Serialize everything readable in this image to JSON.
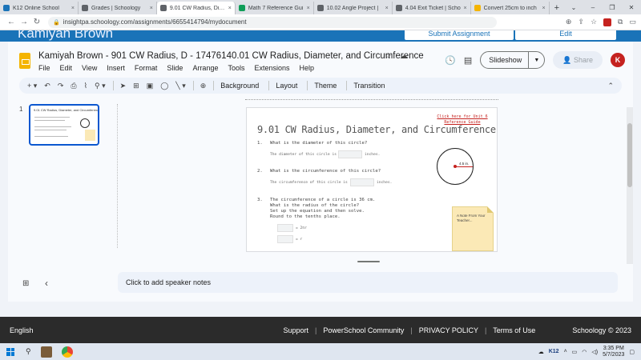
{
  "browser": {
    "tabs": [
      {
        "label": "K12 Online School",
        "color": "#1a73b8",
        "active": false
      },
      {
        "label": "Grades | Schoology",
        "color": "#5f6368",
        "active": false
      },
      {
        "label": "9.01 CW Radius, Diam",
        "color": "#5f6368",
        "active": true
      },
      {
        "label": "Math 7 Reference Gui",
        "color": "#0f9d58",
        "active": false
      },
      {
        "label": "10.02 Angle Project |",
        "color": "#5f6368",
        "active": false
      },
      {
        "label": "4.04 Exit Ticket | Scho",
        "color": "#5f6368",
        "active": false
      },
      {
        "label": "Convert 25cm to inch",
        "color": "#f4b400",
        "active": false
      }
    ],
    "new_tab": "+",
    "close_glyph": "×",
    "url": "insightpa.schoology.com/assignments/6655414794/mydocument"
  },
  "banner": {
    "user_name": "Kamiyah Brown",
    "submit_label": "Submit Assignment",
    "edit_label": "Edit"
  },
  "slides_app": {
    "title": "Kamiyah Brown - 901 CW Radius, D - 17476140.01 CW Radius, Diameter, and Circumference",
    "menus": [
      "File",
      "Edit",
      "View",
      "Insert",
      "Format",
      "Slide",
      "Arrange",
      "Tools",
      "Extensions",
      "Help"
    ],
    "slideshow_label": "Slideshow",
    "share_label": "Share",
    "avatar_letter": "K",
    "toolbar_text": [
      "Background",
      "Layout",
      "Theme",
      "Transition"
    ],
    "slide_number": "1",
    "speaker_notes_placeholder": "Click to add speaker notes"
  },
  "slide": {
    "title": "9.01 CW Radius, Diameter, and Circumference",
    "link_text": "Click here for Unit 6 Reference Guide",
    "q1_num": "1.",
    "q1": "What is the diameter of this circle?",
    "q1_answer_prefix": "The diameter of this circle is",
    "q1_answer_suffix": "inches.",
    "q2_num": "2.",
    "q2": "What is the circumference of this circle?",
    "q2_answer_prefix": "The circumference of this circle is",
    "q2_answer_suffix": "inches.",
    "q3_num": "3.",
    "q3_lines": [
      "The circumference of a circle is 36 cm.",
      "What is the radius of the circle?",
      "Set up the equation and then solve.",
      "Round to the tenths place."
    ],
    "eq1": "= 2πr",
    "eq2": "= r",
    "circle_label": "4.5 in.",
    "note_text": "A Note From Your Teacher..."
  },
  "footer": {
    "language": "English",
    "links": [
      "Support",
      "PowerSchool Community",
      "PRIVACY POLICY",
      "Terms of Use"
    ],
    "copyright": "Schoology © 2023"
  },
  "taskbar": {
    "time": "3:35 PM",
    "date": "5/7/2023",
    "k12_label": "K12"
  }
}
